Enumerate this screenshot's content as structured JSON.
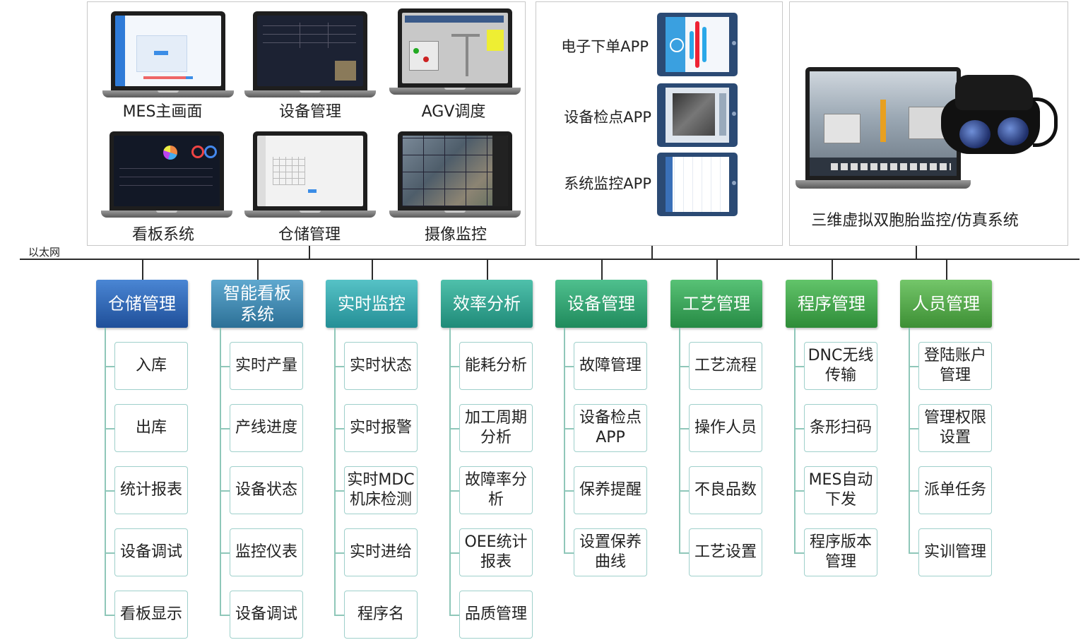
{
  "network_label": "以太网",
  "pc_systems": [
    {
      "label": "MES主画面",
      "screen": "mes"
    },
    {
      "label": "设备管理",
      "screen": "dark-table"
    },
    {
      "label": "AGV调度",
      "screen": "agv"
    },
    {
      "label": "看板系统",
      "screen": "dashboard"
    },
    {
      "label": "仓储管理",
      "screen": "storage"
    },
    {
      "label": "摄像监控",
      "screen": "camera"
    }
  ],
  "apps": [
    {
      "label": "电子下单APP"
    },
    {
      "label": "设备检点APP"
    },
    {
      "label": "系统监控APP"
    }
  ],
  "twin_label": "三维虚拟双胞胎监控/仿真系统",
  "modules": [
    {
      "title": "仓储管理",
      "color_top": "#4a86d4",
      "color_bottom": "#1f4f99",
      "items": [
        "入库",
        "出库",
        "统计报表",
        "设备调试",
        "看板显示"
      ]
    },
    {
      "title": "智能看板\n系统",
      "color_top": "#5fa8cf",
      "color_bottom": "#2c7096",
      "items": [
        "实时产量",
        "产线进度",
        "设备状态",
        "监控仪表",
        "设备调试"
      ]
    },
    {
      "title": "实时监控",
      "color_top": "#56c2c6",
      "color_bottom": "#248f96",
      "items": [
        "实时状态",
        "实时报警",
        "实时MDC\n机床检测",
        "实时进给",
        "程序名"
      ]
    },
    {
      "title": "效率分析",
      "color_top": "#4fc0ab",
      "color_bottom": "#1f8a78",
      "items": [
        "能耗分析",
        "加工周期\n分析",
        "故障率分\n析",
        "OEE统计\n报表",
        "品质管理"
      ]
    },
    {
      "title": "设备管理",
      "color_top": "#4fc08e",
      "color_bottom": "#1f8a5c",
      "items": [
        "故障管理",
        "设备检点\nAPP",
        "保养提醒",
        "设置保养\n曲线"
      ]
    },
    {
      "title": "工艺管理",
      "color_top": "#58c276",
      "color_bottom": "#268a44",
      "items": [
        "工艺流程",
        "操作人员",
        "不良品数",
        "工艺设置"
      ]
    },
    {
      "title": "程序管理",
      "color_top": "#62c46a",
      "color_bottom": "#2e8c38",
      "items": [
        "DNC无线\n传输",
        "条形扫码",
        "MES自动\n下发",
        "程序版本\n管理"
      ]
    },
    {
      "title": "人员管理",
      "color_top": "#74c66a",
      "color_bottom": "#3d8f34",
      "items": [
        "登陆账户\n管理",
        "管理权限\n设置",
        "派单任务",
        "实训管理"
      ]
    }
  ]
}
